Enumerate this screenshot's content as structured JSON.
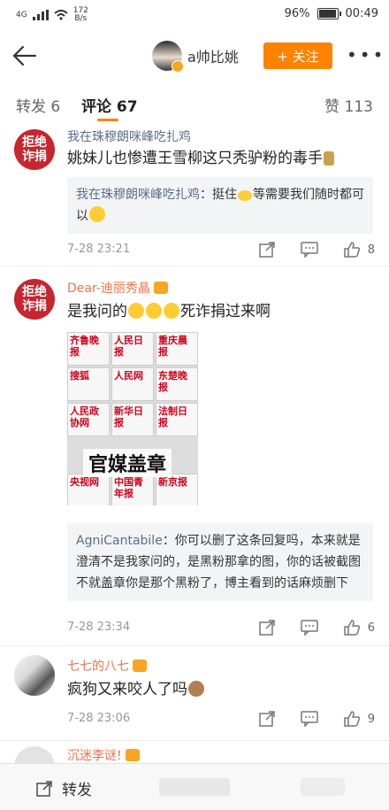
{
  "status_bar": {
    "network": "4G",
    "speed_value": "172",
    "speed_unit": "B/s",
    "battery": "96%",
    "battery_level": 0.96,
    "time": "00:49"
  },
  "header": {
    "username": "a帅比姚",
    "follow_label": "+ 关注",
    "more_label": "•••"
  },
  "tabs": {
    "reposts": "转发 6",
    "comments": "评论 67",
    "likes": "赞 113"
  },
  "comments": [
    {
      "avatar_text": "拒绝诈捐",
      "name": "我在珠穆朗咪峰吃扎鸡",
      "text": "姚妹儿也惨遭王雪柳这只秃驴粉的毒手",
      "reply_name": "我在珠穆朗咪峰吃扎鸡",
      "reply_text": "：挺住",
      "reply_text2": "等需要我们随时都可以",
      "time": "7-28 23:21",
      "likes": "8"
    },
    {
      "avatar_text": "拒绝诈捐",
      "name": "Dear-迪丽秀晶",
      "text_a": "是我问的",
      "text_b": "死诈捐过来啊",
      "collage_labels": [
        "齐鲁晚报",
        "人民日报",
        "重庆晨报",
        "搜狐",
        "人民网",
        "东楚晚报",
        "人民政协网",
        "新华日报",
        "法制日报",
        "央视网",
        "中国青年报",
        "新京报"
      ],
      "stamp": "官媒盖章",
      "reply_name": "AgniCantabile",
      "reply_text": "：你可以删了这条回复吗，本来就是澄清不是我家问的，是黑粉那拿的图，你的话被截图不就盖章你是那个黑粉了，博主看到的话麻烦删下",
      "time": "7-28 23:34",
      "likes": "6"
    },
    {
      "name": "七七的八七",
      "text": "疯狗又来咬人了吗",
      "time": "7-28 23:06",
      "likes": "9"
    },
    {
      "name": "沉迷李谜!"
    }
  ],
  "bottom_bar": {
    "repost_label": "转发"
  }
}
